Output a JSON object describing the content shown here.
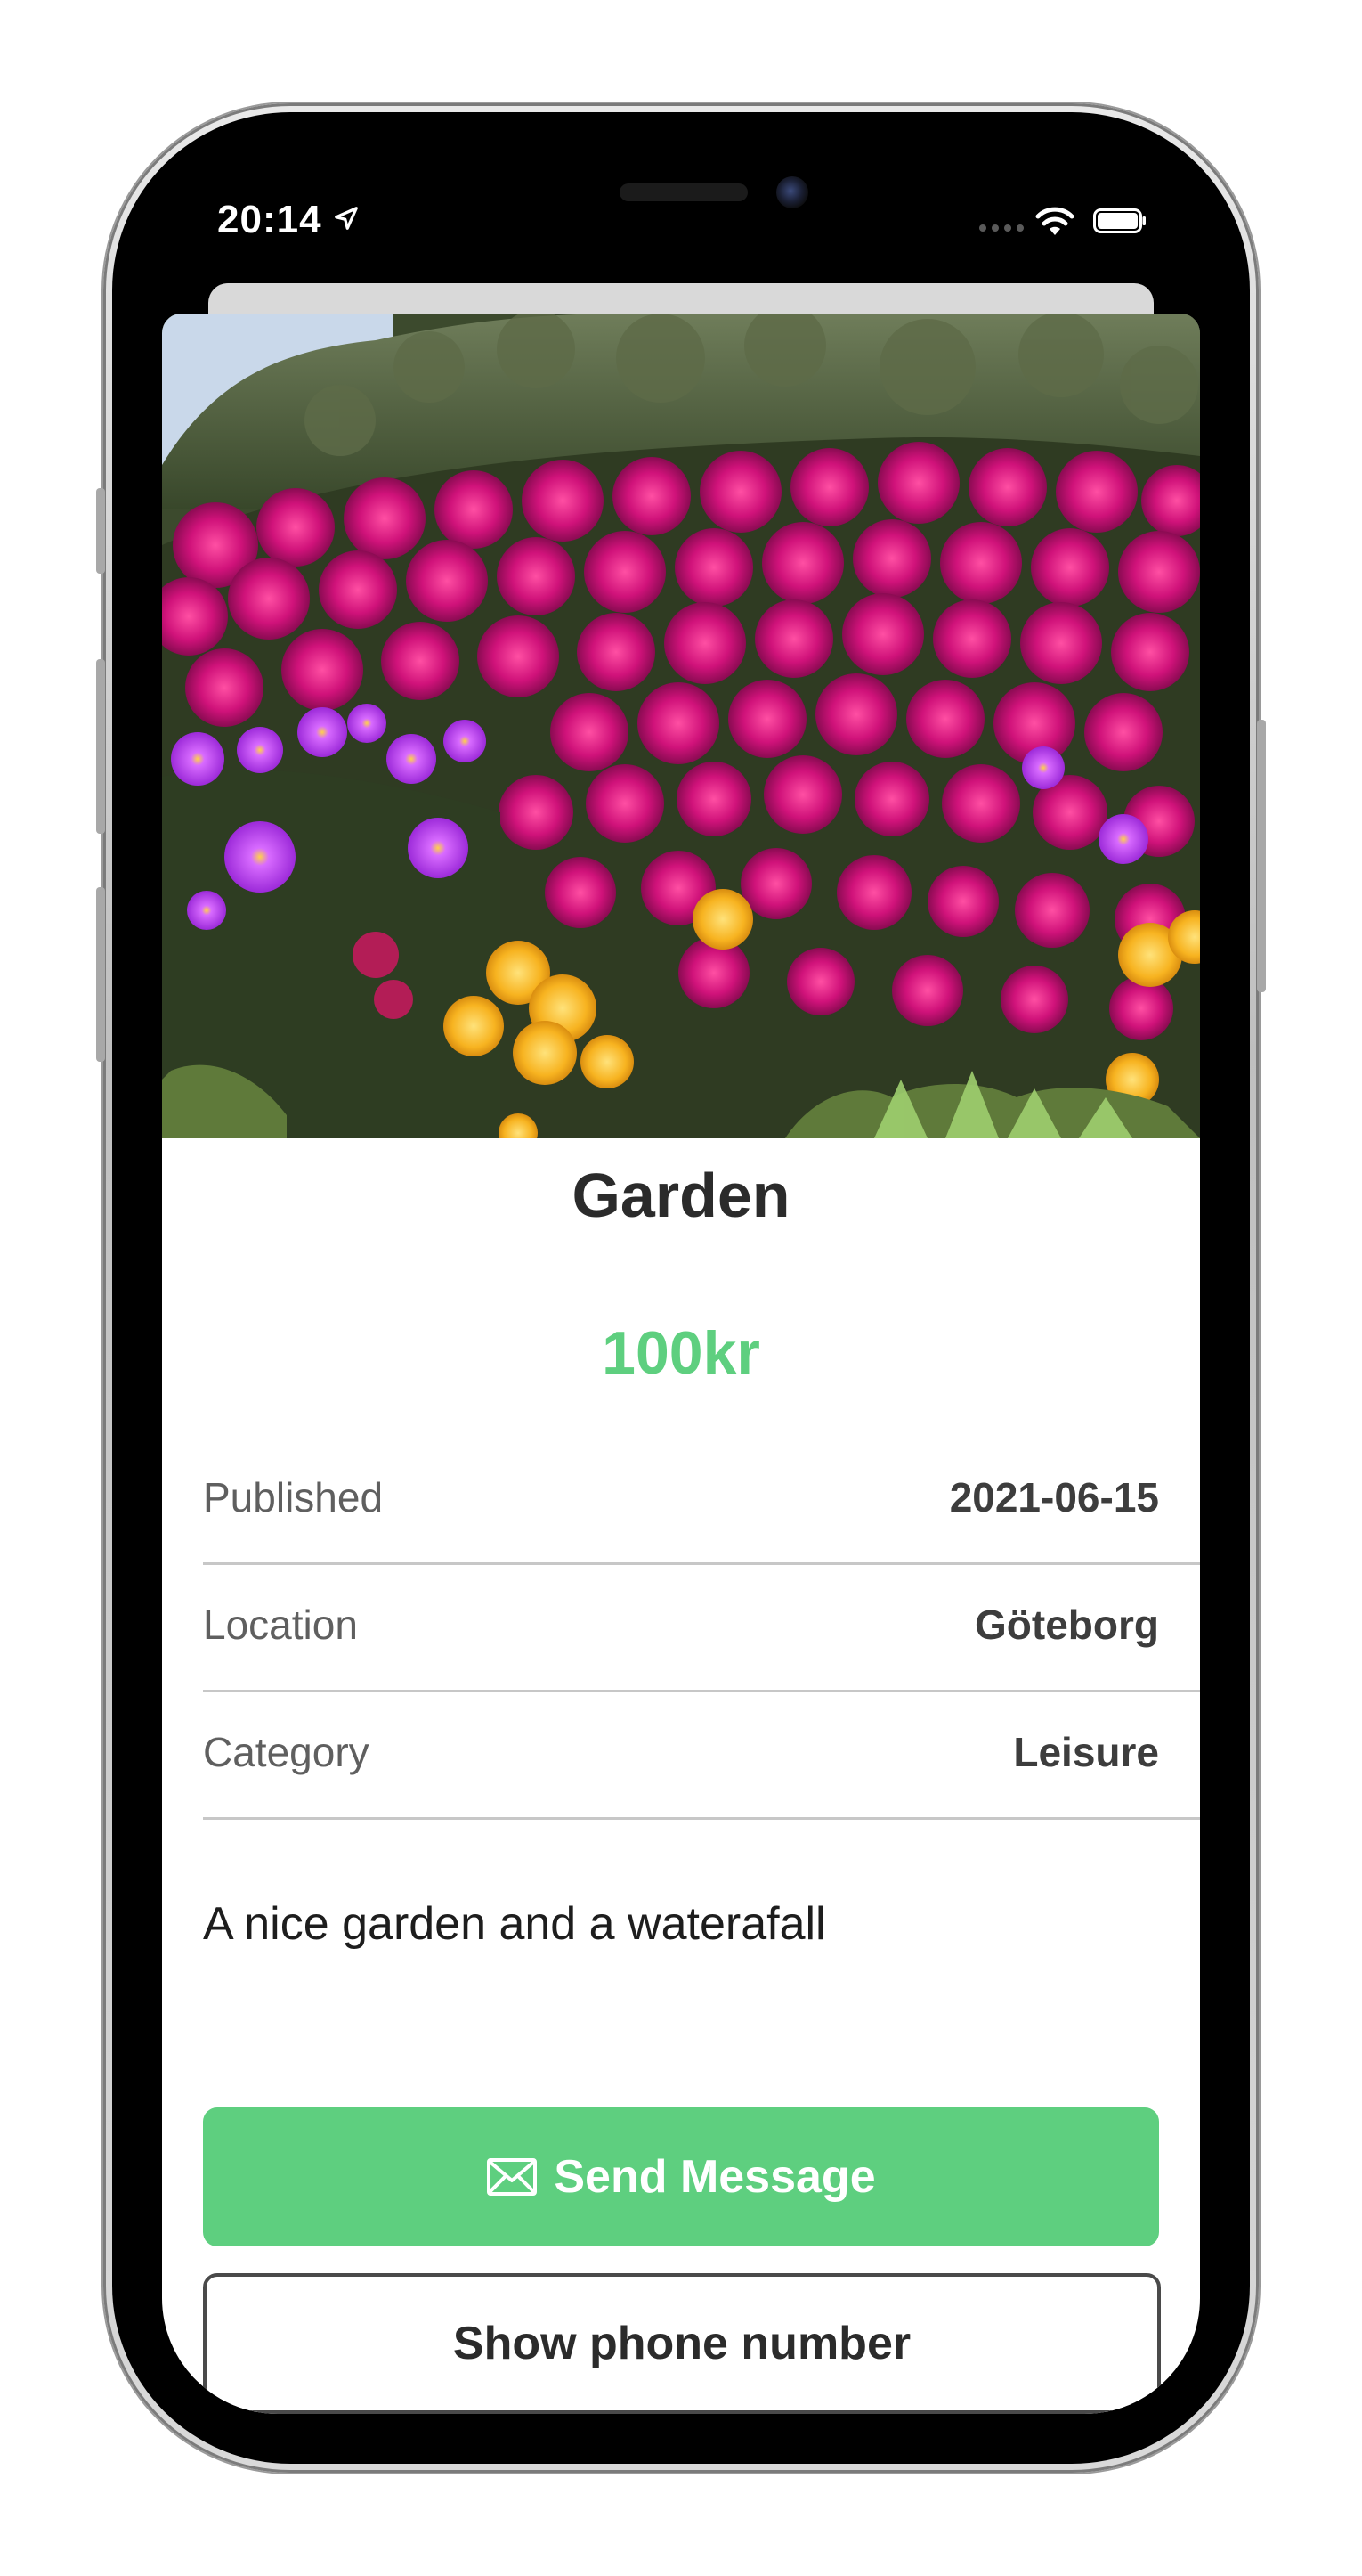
{
  "status_bar": {
    "time": "20:14",
    "icons": [
      "location-arrow-icon",
      "cellular-signal-icon",
      "wifi-icon",
      "battery-icon"
    ]
  },
  "listing": {
    "image_alt": "",
    "title": "Garden",
    "price": "100kr",
    "details": [
      {
        "label": "Published",
        "value": "2021-06-15"
      },
      {
        "label": "Location",
        "value": "Göteborg"
      },
      {
        "label": "Category",
        "value": "Leisure"
      }
    ],
    "description": "A nice garden and a waterafall"
  },
  "actions": {
    "send_message_label": "Send Message",
    "send_message_icon": "envelope-icon",
    "show_phone_label": "Show phone number"
  },
  "colors": {
    "accent_green": "#5ecf7f",
    "text_dark": "#2b2b2b",
    "text_muted": "#5f5f5f",
    "divider": "#c7c7c7"
  }
}
